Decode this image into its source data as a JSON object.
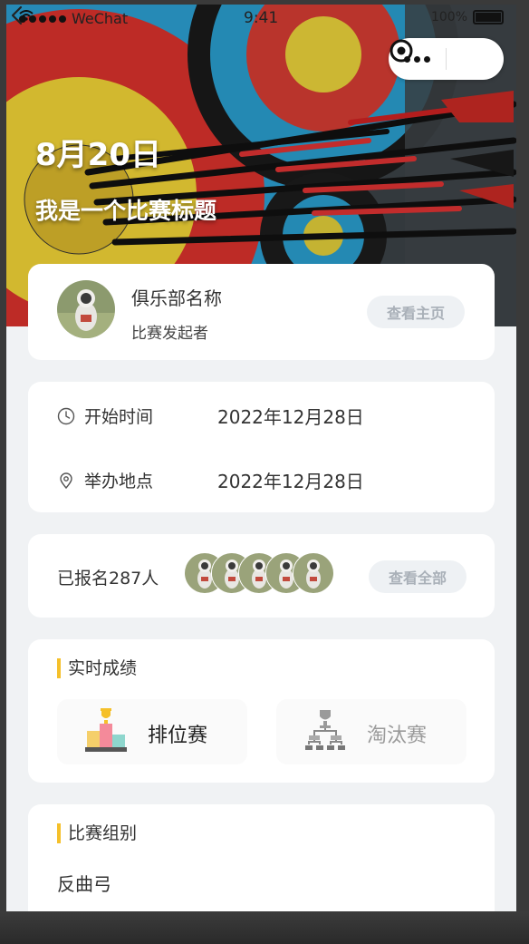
{
  "status_bar": {
    "carrier": "WeChat",
    "time": "9:41",
    "battery": "100%"
  },
  "header": {
    "date": "8月20日",
    "title": "我是一个比赛标题"
  },
  "organizer": {
    "club_name": "俱乐部名称",
    "role": "比赛发起者",
    "view_button": "查看主页"
  },
  "info": {
    "start_label": "开始时间",
    "start_value": "2022年12月28日",
    "location_label": "举办地点",
    "location_value": "2022年12月28日"
  },
  "registration": {
    "text": "已报名287人",
    "view_all_button": "查看全部"
  },
  "scores": {
    "title": "实时成绩",
    "ranking_label": "排位赛",
    "knockout_label": "淘汰赛"
  },
  "group": {
    "title": "比赛组别",
    "value": "反曲弓"
  },
  "colors": {
    "accent": "#f5c02a",
    "background": "#f0f2f4",
    "pill_bg": "#eef1f4"
  }
}
